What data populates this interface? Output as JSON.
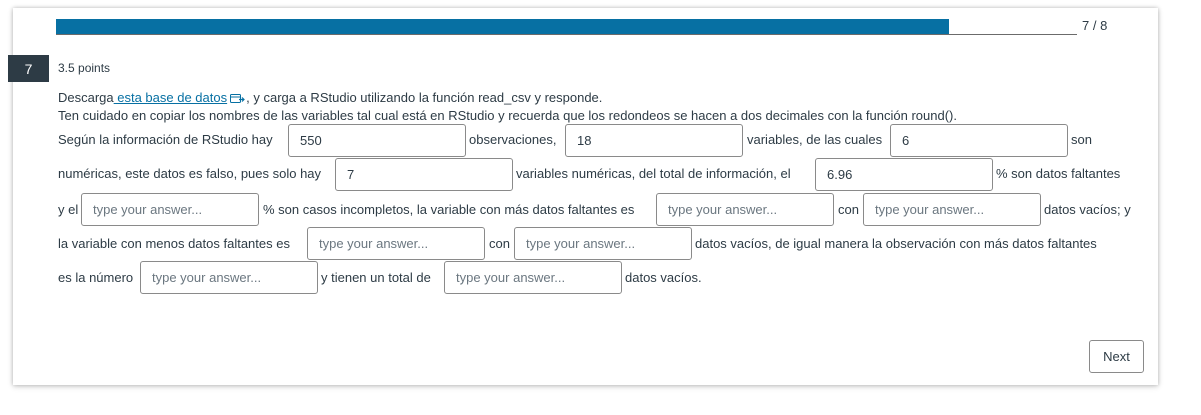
{
  "progress": {
    "fraction": 0.875,
    "label": "7 / 8"
  },
  "question": {
    "number": "7",
    "points": "3.5 points",
    "intro": {
      "before_link": "Descarga",
      "link_text": " esta base de datos",
      "after_link": ", y carga a RStudio utilizando la función read_csv y responde."
    },
    "instructions": "Ten cuidado en copiar los nombres de las variables tal cual está en RStudio y recuerda que los redondeos se hacen a dos decimales con la función round().",
    "texts": {
      "s1": "Según la información de RStudio hay",
      "s2": "observaciones,",
      "s3": "variables, de las cuales",
      "s4": "son",
      "s5": "numéricas, este datos es falso, pues solo hay",
      "s6": "variables numéricas, del total de información, el",
      "s7": "% son datos faltantes",
      "s8": "y el",
      "s9": "% son casos incompletos, la variable con más datos faltantes es",
      "s10": "con",
      "s11": "datos vacíos; y",
      "s12": "la variable con menos datos faltantes es",
      "s13": "con",
      "s14": "datos vacíos, de igual manera la observación con más datos faltantes",
      "s15": "es la número",
      "s16": "y tienen un total de",
      "s17": "datos vacíos."
    },
    "answers": {
      "a1": "550",
      "a2": "18",
      "a3": "6",
      "a4": "7",
      "a5": "6.96",
      "a6": "",
      "a7": "",
      "a8": "",
      "a9": "",
      "a10": "",
      "a11": "",
      "a12": ""
    },
    "placeholder": "type your answer..."
  },
  "next_label": "Next"
}
